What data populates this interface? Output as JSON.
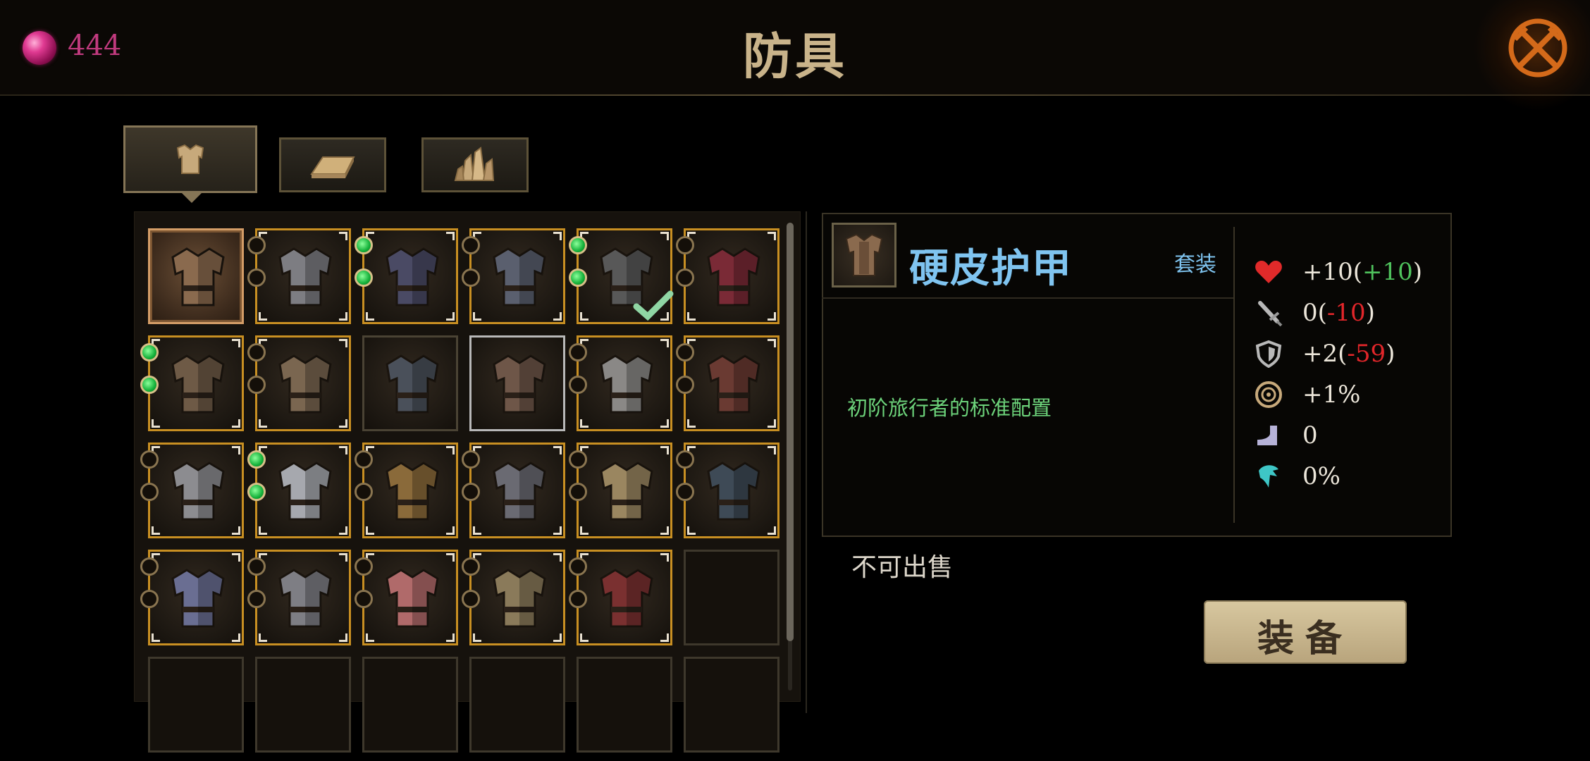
{
  "header": {
    "gem_count": "444",
    "title": "防具",
    "close_icon": "crossed-swords-close-icon"
  },
  "category_tabs": [
    {
      "name": "armor",
      "icon": "armor-icon",
      "active": true
    },
    {
      "name": "ingots",
      "icon": "ingot-icon",
      "active": false
    },
    {
      "name": "crystals",
      "icon": "crystal-icon",
      "active": false
    }
  ],
  "inventory": {
    "rows": [
      [
        {
          "color": "#8a6a4e",
          "frame": "selected",
          "dots": [],
          "equipped": false
        },
        {
          "color": "#7d7d82",
          "frame": "gold",
          "dots": [
            0,
            0
          ],
          "equipped": false
        },
        {
          "color": "#4a4a64",
          "frame": "gold",
          "dots": [
            1,
            1
          ],
          "equipped": false
        },
        {
          "color": "#5a5f6e",
          "frame": "gold",
          "dots": [
            0,
            0
          ],
          "equipped": false
        },
        {
          "color": "#585858",
          "frame": "gold",
          "dots": [
            1,
            1
          ],
          "equipped": true
        },
        {
          "color": "#7a2a36",
          "frame": "gold",
          "dots": [
            0,
            0
          ],
          "equipped": false
        }
      ],
      [
        {
          "color": "#6e5a46",
          "frame": "gold",
          "dots": [
            1,
            1
          ],
          "equipped": false
        },
        {
          "color": "#7a6650",
          "frame": "gold",
          "dots": [
            0,
            0
          ],
          "equipped": false
        },
        {
          "color": "#4a505a",
          "frame": "plain",
          "dots": [],
          "equipped": false
        },
        {
          "color": "#6e5648",
          "frame": "white",
          "dots": [],
          "equipped": false
        },
        {
          "color": "#8a8886",
          "frame": "gold",
          "dots": [
            0,
            0
          ],
          "equipped": false
        },
        {
          "color": "#6a3a32",
          "frame": "gold",
          "dots": [
            0,
            0
          ],
          "equipped": false
        }
      ],
      [
        {
          "color": "#8c8c90",
          "frame": "gold",
          "dots": [
            0,
            0
          ],
          "equipped": false
        },
        {
          "color": "#a6a8ae",
          "frame": "gold",
          "dots": [
            1,
            1
          ],
          "equipped": false
        },
        {
          "color": "#8a6a3a",
          "frame": "gold",
          "dots": [
            0,
            0
          ],
          "equipped": false
        },
        {
          "color": "#6a6a72",
          "frame": "gold",
          "dots": [
            0,
            0
          ],
          "equipped": false
        },
        {
          "color": "#9a8660",
          "frame": "gold",
          "dots": [
            0,
            0
          ],
          "equipped": false
        },
        {
          "color": "#3e4a56",
          "frame": "gold",
          "dots": [
            0,
            0
          ],
          "equipped": false
        }
      ],
      [
        {
          "color": "#6a6e92",
          "frame": "gold",
          "dots": [
            0,
            0
          ],
          "equipped": false
        },
        {
          "color": "#7e7e84",
          "frame": "gold",
          "dots": [
            0,
            0
          ],
          "equipped": false
        },
        {
          "color": "#b06a6a",
          "frame": "gold",
          "dots": [
            0,
            0
          ],
          "equipped": false
        },
        {
          "color": "#8a7a5a",
          "frame": "gold",
          "dots": [
            0,
            0
          ],
          "equipped": false
        },
        {
          "color": "#7a3030",
          "frame": "gold",
          "dots": [
            0,
            0
          ],
          "equipped": false
        },
        {
          "color": "",
          "frame": "empty",
          "dots": [],
          "equipped": false
        }
      ],
      [
        {
          "color": "",
          "frame": "empty",
          "dots": [],
          "equipped": false
        },
        {
          "color": "",
          "frame": "empty",
          "dots": [],
          "equipped": false
        },
        {
          "color": "",
          "frame": "empty",
          "dots": [],
          "equipped": false
        },
        {
          "color": "",
          "frame": "empty",
          "dots": [],
          "equipped": false
        },
        {
          "color": "",
          "frame": "empty",
          "dots": [],
          "equipped": false
        },
        {
          "color": "",
          "frame": "empty",
          "dots": [],
          "equipped": false
        }
      ]
    ]
  },
  "detail": {
    "item_name": "硬皮护甲",
    "set_label": "套装",
    "description": "初阶旅行者的标准配置",
    "sell_status": "不可出售",
    "equip_label": "装备",
    "stats": [
      {
        "icon": "heart-icon",
        "base": "+10",
        "delta": "+10",
        "delta_kind": "pos"
      },
      {
        "icon": "sword-icon",
        "base": "0",
        "delta": "-10",
        "delta_kind": "neg"
      },
      {
        "icon": "shield-icon",
        "base": "+2",
        "delta": "-59",
        "delta_kind": "neg"
      },
      {
        "icon": "critical-icon",
        "base": "+1%",
        "delta": "",
        "delta_kind": ""
      },
      {
        "icon": "boot-icon",
        "base": "0",
        "delta": "",
        "delta_kind": ""
      },
      {
        "icon": "dodge-icon",
        "base": "0%",
        "delta": "",
        "delta_kind": ""
      }
    ]
  },
  "colors": {
    "gem": "#c03a7e",
    "title": "#c9b38a",
    "item_name": "#7fc4f0",
    "description": "#6cd27a",
    "positive": "#4fc35d",
    "negative": "#e2262a"
  }
}
